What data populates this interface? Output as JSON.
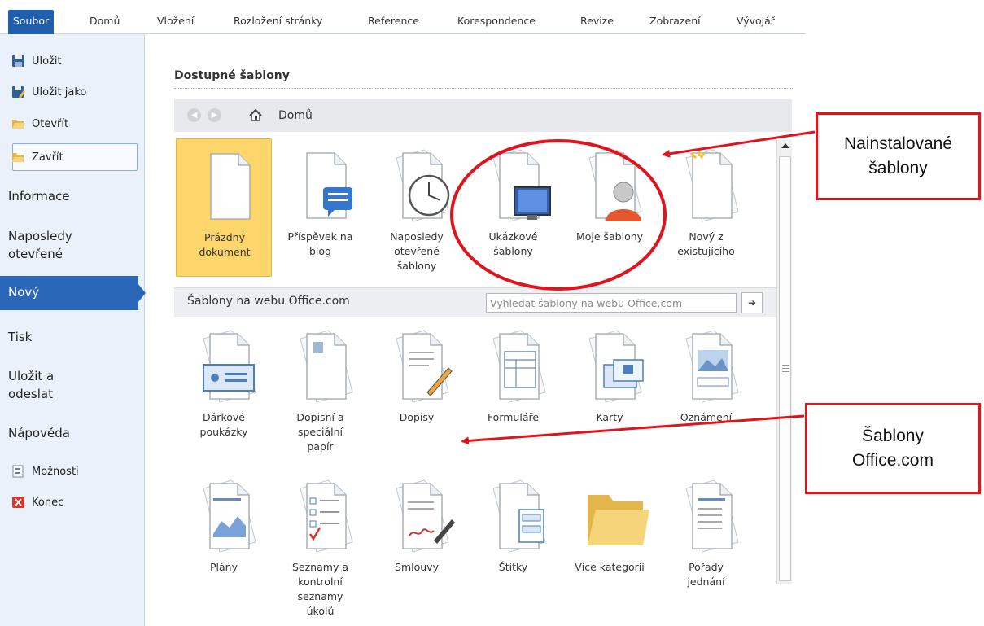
{
  "ribbon": {
    "tabs": [
      "Soubor",
      "Domů",
      "Vložení",
      "Rozložení stránky",
      "Reference",
      "Korespondence",
      "Revize",
      "Zobrazení",
      "Vývojář"
    ]
  },
  "backstage": {
    "save": "Uložit",
    "save_as": "Uložit jako",
    "open": "Otevřít",
    "close": "Zavřít",
    "info": "Informace",
    "recent": "Naposledy\notevřené",
    "new": "Nový",
    "print": "Tisk",
    "save_send": "Uložit a\nodeslat",
    "help": "Nápověda",
    "options": "Možnosti",
    "exit": "Konec"
  },
  "main": {
    "title": "Dostupné šablony",
    "nav_home": "Domů",
    "installed_templates": [
      {
        "label": "Prázdný\ndokument",
        "icon": "blank-document-icon",
        "selected": true
      },
      {
        "label": "Příspěvek na\nblog",
        "icon": "blog-post-icon"
      },
      {
        "label": "Naposledy\notevřené\nšablony",
        "icon": "recent-templates-icon"
      },
      {
        "label": "Ukázkové\nšablony",
        "icon": "sample-templates-icon"
      },
      {
        "label": "Moje šablony",
        "icon": "my-templates-icon"
      },
      {
        "label": "Nový z\nexistujícího",
        "icon": "new-from-existing-icon"
      }
    ],
    "web_section_title": "Šablony na webu Office.com",
    "web_search_placeholder": "Vyhledat šablony na webu Office.com",
    "office_templates_row1": [
      {
        "label": "Dárkové\npoukázky",
        "icon": "gift-certificate-icon"
      },
      {
        "label": "Dopisní a\nspeciální\npapír",
        "icon": "stationery-icon"
      },
      {
        "label": "Dopisy",
        "icon": "letters-icon"
      },
      {
        "label": "Formuláře",
        "icon": "forms-icon"
      },
      {
        "label": "Karty",
        "icon": "cards-icon"
      },
      {
        "label": "Oznámení",
        "icon": "announcements-icon"
      }
    ],
    "office_templates_row2": [
      {
        "label": "Plány",
        "icon": "plans-icon"
      },
      {
        "label": "Seznamy a\nkontrolní\nseznamy\núkolů",
        "icon": "checklists-icon"
      },
      {
        "label": "Smlouvy",
        "icon": "contracts-icon"
      },
      {
        "label": "Štítky",
        "icon": "labels-icon"
      },
      {
        "label": "Více kategorií",
        "icon": "folder-icon"
      },
      {
        "label": "Pořady\njednání",
        "icon": "agenda-icon"
      }
    ]
  },
  "callouts": {
    "installed": "Nainstalované\nšablony",
    "office": "Šablony\nOffice.com"
  },
  "colors": {
    "file_tab": "#1f5fae",
    "backstage_bg": "#eaf1fb",
    "selected_nav": "#2a67b8",
    "selected_tile": "#fcd66a",
    "annotation_red": "#e0141c"
  }
}
